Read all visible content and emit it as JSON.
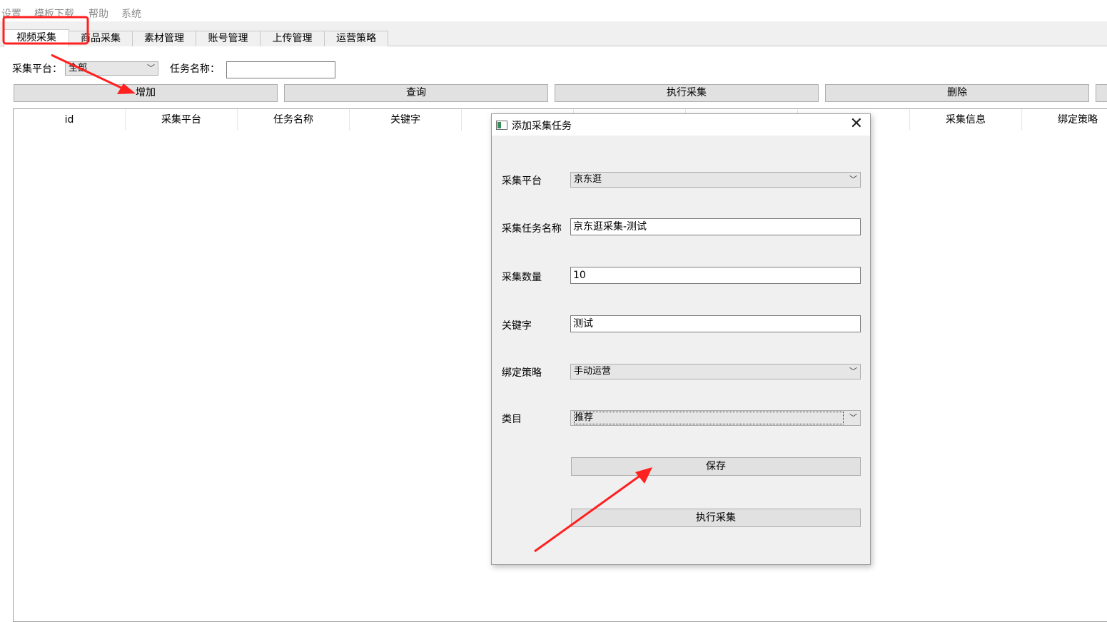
{
  "menu": {
    "items": [
      "设置",
      "模板下载",
      "帮助",
      "系统"
    ]
  },
  "tabs": [
    "视频采集",
    "商品采集",
    "素材管理",
    "账号管理",
    "上传管理",
    "运营策略"
  ],
  "filters": {
    "platform_label": "采集平台：",
    "platform_value": "全部",
    "task_name_label": "任务名称：",
    "task_name_value": ""
  },
  "toolbar": {
    "add": "增加",
    "query": "查询",
    "run": "执行采集",
    "delete": "删除"
  },
  "table": {
    "columns": [
      "id",
      "采集平台",
      "任务名称",
      "关键字",
      "采",
      "",
      "",
      "态",
      "采集信息",
      "绑定策略"
    ]
  },
  "dialog": {
    "title": "添加采集任务",
    "close_glyph": "✕",
    "fields": {
      "platform_label": "采集平台",
      "platform_value": "京东逛",
      "task_name_label": "采集任务名称",
      "task_name_value": "京东逛采集-测试",
      "count_label": "采集数量",
      "count_value": "10",
      "keyword_label": "关键字",
      "keyword_value": "测试",
      "strategy_label": "绑定策略",
      "strategy_value": "手动运营",
      "category_label": "类目",
      "category_value": "推荐"
    },
    "save": "保存",
    "run": "执行采集"
  },
  "colors": {
    "highlight": "#ff2020",
    "arrow": "#ff2020",
    "tabbar_bg": "#f0f0f0",
    "dialog_bg": "#f0f0f0"
  }
}
